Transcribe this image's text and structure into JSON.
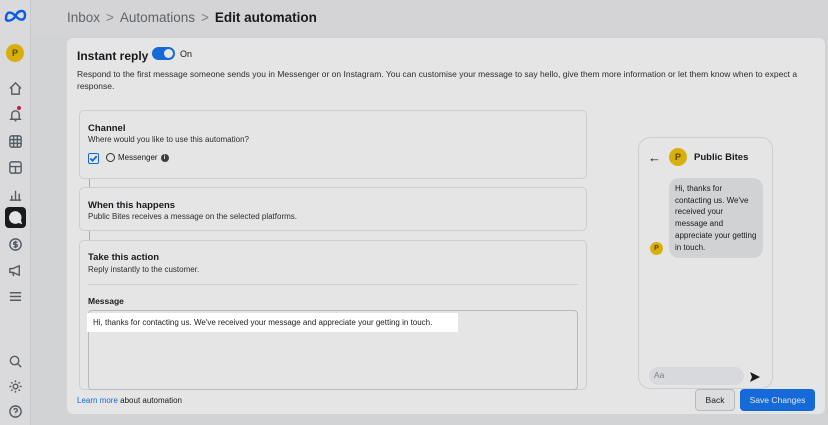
{
  "breadcrumb": {
    "items": [
      "Inbox",
      "Automations"
    ],
    "current": "Edit automation"
  },
  "sidebar": {
    "profile_initial": "P",
    "icons": [
      "meta-logo",
      "home-icon",
      "notifications-icon",
      "grid-icon",
      "pages-icon",
      "insights-icon",
      "inbox-icon",
      "monetization-icon",
      "ads-icon",
      "menu-icon",
      "search-icon",
      "settings-icon",
      "help-icon"
    ]
  },
  "header": {
    "title": "Instant reply",
    "toggle_label": "On",
    "description": "Respond to the first message someone sends you in Messenger or on Instagram. You can customise your message to say hello, give them more information or let them know when to expect a response."
  },
  "channel": {
    "title": "Channel",
    "subtitle": "Where would you like to use this automation?",
    "option": "Messenger",
    "checked": true
  },
  "trigger": {
    "title": "When this happens",
    "subtitle": "Public Bites receives a message on the selected platforms."
  },
  "action": {
    "title": "Take this action",
    "subtitle": "Reply instantly to the customer.",
    "message_label": "Message",
    "message_text": "Hi, thanks for contacting us. We've received your message and appreciate your getting in touch."
  },
  "footer": {
    "learn_more": "Learn more",
    "learn_more_suffix": " about automation",
    "back_label": "Back",
    "save_label": "Save Changes"
  },
  "preview": {
    "page_initial": "P",
    "page_name": "Public Bites",
    "bubble_text": "Hi, thanks for contacting us. We've received your message and appreciate your getting in touch.",
    "input_placeholder": "Aa"
  },
  "colors": {
    "accent": "#1877f2",
    "avatar": "#f1c40f"
  }
}
